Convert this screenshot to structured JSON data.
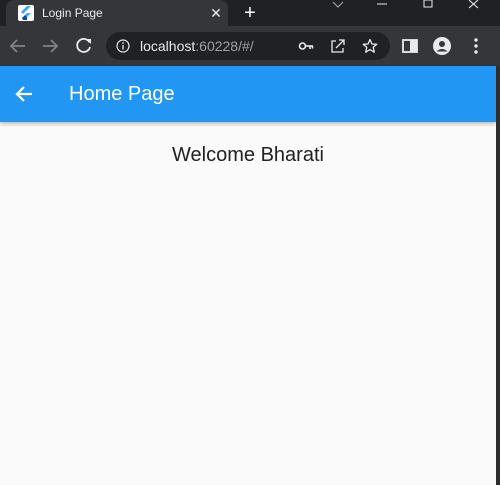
{
  "browser": {
    "tab": {
      "title": "Login Page",
      "favicon": "flutter-icon"
    },
    "new_tab_icon": "plus-icon",
    "url": {
      "host": "localhost",
      "rest": ":60228/#/"
    }
  },
  "app": {
    "appbar": {
      "title": "Home Page",
      "color": "#2196f3",
      "back_icon": "arrow-back-icon"
    },
    "welcome_text": "Welcome Bharati"
  }
}
